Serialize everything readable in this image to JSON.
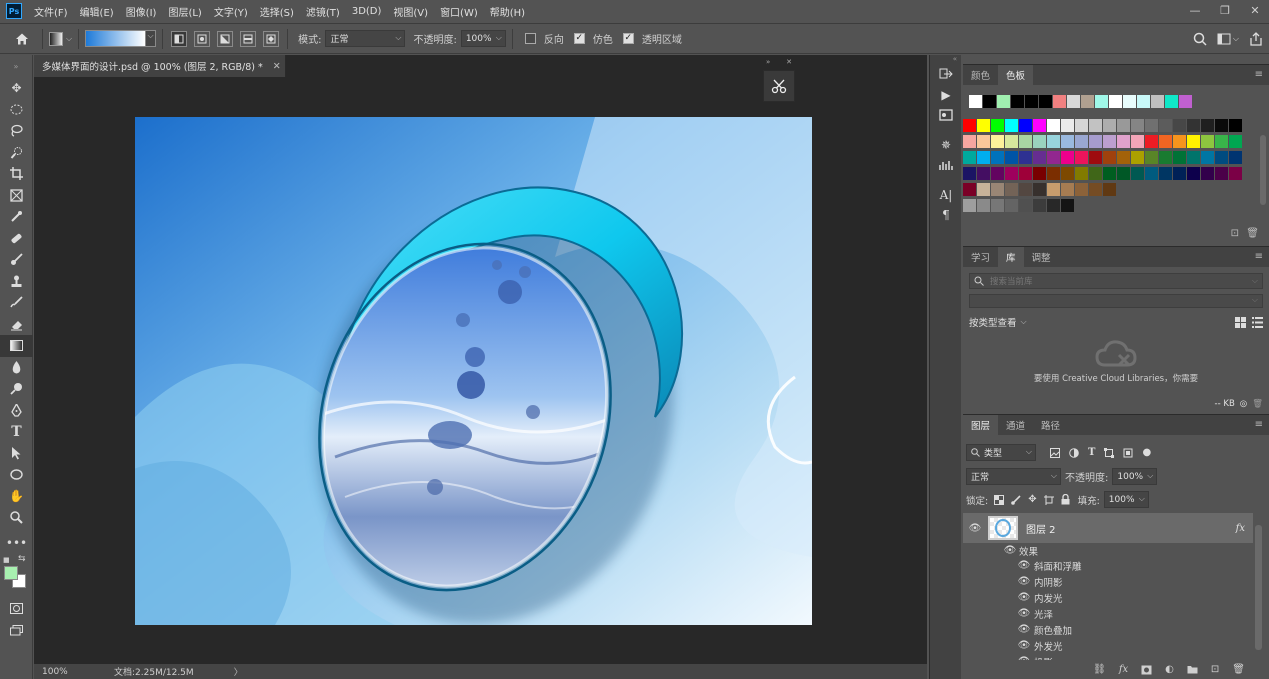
{
  "app": {
    "logo": "Ps"
  },
  "menu": [
    "文件(F)",
    "编辑(E)",
    "图像(I)",
    "图层(L)",
    "文字(Y)",
    "选择(S)",
    "滤镜(T)",
    "3D(D)",
    "视图(V)",
    "窗口(W)",
    "帮助(H)"
  ],
  "options": {
    "mode_label": "模式:",
    "mode_value": "正常",
    "opacity_label": "不透明度:",
    "opacity_value": "100%",
    "reverse_label": "反向",
    "dither_label": "仿色",
    "transparency_label": "透明区域",
    "reverse_checked": false,
    "dither_checked": true,
    "transparency_checked": true
  },
  "document": {
    "tab_title": "多媒体界面的设计.psd @ 100% (图层 2, RGB/8) *",
    "zoom": "100%",
    "doc_info": "文档:2.25M/12.5M"
  },
  "colors": {
    "foreground": "#a8f0b0",
    "background": "#ffffff",
    "accent": "#31a8ff"
  },
  "swatch_panel": {
    "tabs": [
      "颜色",
      "色板"
    ],
    "active_tab": "色板",
    "recent": [
      "#ffffff",
      "#000000",
      "#a0f0b0",
      "#000000",
      "#000000",
      "#000000",
      "#f08080",
      "#d8d8d8",
      "#b0a090",
      "#a0f8e8",
      "#ffffff",
      "#e8fcfc",
      "#c8f8f8",
      "#c0c0c0",
      "#10e8c8",
      "#c060d0"
    ],
    "rows": [
      [
        "#ff0000",
        "#ffff00",
        "#00ff00",
        "#00ffff",
        "#0000ff",
        "#ff00ff",
        "#ffffff",
        "#ebebeb",
        "#d6d6d6",
        "#c2c2c2",
        "#adadad",
        "#999999",
        "#858585",
        "#707070",
        "#5c5c5c",
        "#474747",
        "#333333",
        "#1f1f1f",
        "#0a0a0a",
        "#000000"
      ],
      [
        "#f6a6a0",
        "#f9c79a",
        "#fdf19a",
        "#d7e89d",
        "#a8d5a2",
        "#9ad3be",
        "#98d4dc",
        "#9ab9df",
        "#9aa7d2",
        "#a69cce",
        "#bc9fcf",
        "#e0a1cc",
        "#f3a5b8",
        "#ed1c24",
        "#f26522",
        "#f7941d",
        "#fff200",
        "#8dc63f",
        "#39b54a",
        "#00a651"
      ],
      [
        "#00a99d",
        "#00aeef",
        "#0072bc",
        "#0054a6",
        "#2e3192",
        "#662d91",
        "#92278f",
        "#ec008c",
        "#ed145b",
        "#9e0b0f",
        "#a0410d",
        "#a36209",
        "#aba000",
        "#598527",
        "#197b30",
        "#007236",
        "#00746b",
        "#0076a3",
        "#004b80",
        "#003471"
      ],
      [
        "#1b1464",
        "#440e62",
        "#630460",
        "#9e005d",
        "#9e0039",
        "#790000",
        "#7b2e00",
        "#7d4900",
        "#827b00",
        "#406618",
        "#005e20",
        "#005826",
        "#005952",
        "#005b7f",
        "#003663",
        "#002157",
        "#0d004c",
        "#32004b",
        "#4b0049",
        "#7b0046"
      ],
      [
        "#7a0026",
        "#c7b299",
        "#998675",
        "#736357",
        "#534741",
        "#37302d",
        "#c69c6d",
        "#a67c52",
        "#8c6239",
        "#754c24",
        "#603913"
      ]
    ],
    "greys": [
      "#9e9e9e",
      "#8a8a8a",
      "#777777",
      "#646464",
      "#505050",
      "#3c3c3c",
      "#282828",
      "#141414"
    ]
  },
  "library_panel": {
    "tabs": [
      "学习",
      "库",
      "调整"
    ],
    "active_tab": "库",
    "search_placeholder": "搜索当前库",
    "view_label": "按类型查看",
    "cloud_message": "要使用 Creative Cloud Libraries，你需要",
    "size_label": "-- KB"
  },
  "layers_panel": {
    "tabs": [
      "图层",
      "通道",
      "路径"
    ],
    "active_tab": "图层",
    "filter_label": "类型",
    "blend_mode": "正常",
    "opacity_label": "不透明度:",
    "opacity_value": "100%",
    "lock_label": "锁定:",
    "fill_label": "填充:",
    "fill_value": "100%",
    "layer_name": "图层 2",
    "fx_label": "fx",
    "effects_label": "效果",
    "effects": [
      "斜面和浮雕",
      "内阴影",
      "内发光",
      "光泽",
      "颜色叠加",
      "外发光",
      "投影"
    ]
  },
  "tools": [
    "move-tool-icon",
    "marquee-tool-icon",
    "lasso-tool-icon",
    "quick-select-tool-icon",
    "crop-tool-icon",
    "frame-tool-icon",
    "eyedropper-tool-icon",
    "healing-brush-tool-icon",
    "brush-tool-icon",
    "clone-stamp-tool-icon",
    "history-brush-tool-icon",
    "eraser-tool-icon",
    "gradient-tool-icon",
    "blur-tool-icon",
    "dodge-tool-icon",
    "pen-tool-icon",
    "type-tool-icon",
    "path-select-tool-icon",
    "ellipse-tool-icon",
    "hand-tool-icon",
    "zoom-tool-icon",
    "more-tools-icon"
  ]
}
